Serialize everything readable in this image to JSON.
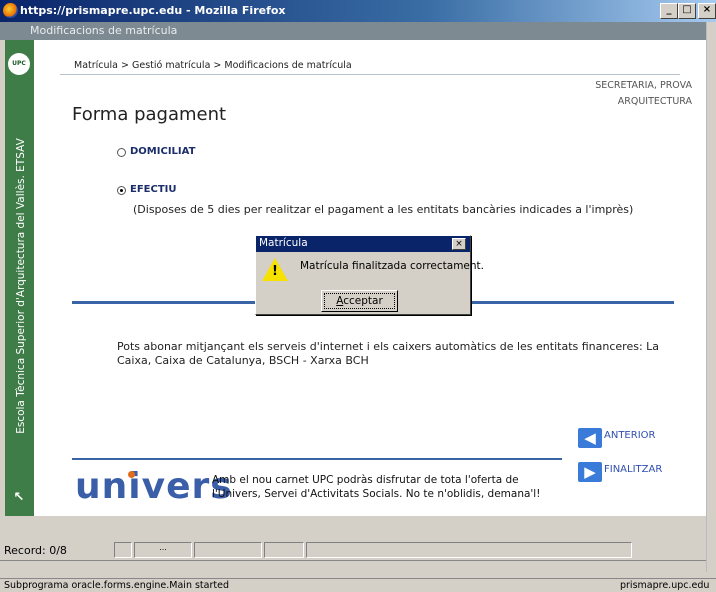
{
  "window": {
    "title": "https://prismapre.upc.edu - Mozilla Firefox",
    "controls": {
      "minimize": "_",
      "maximize": "□",
      "close": "×"
    }
  },
  "app": {
    "header": "Modificacions de matrícula",
    "sidebar_text": "Escola Tècnica Superior d'Arquitectura del Vallès. ETSAV",
    "logo_text": "UPC",
    "sidebar_arrow": "↖"
  },
  "breadcrumb": "Matrícula > Gestió matrícula > Modificacions de matrícula",
  "user": {
    "line1": "SECRETARIA, PROVA",
    "line2": "ARQUITECTURA"
  },
  "page_title": "Forma pagament",
  "options": [
    {
      "label": "DOMICILIAT",
      "selected": false
    },
    {
      "label": "EFECTIU",
      "selected": true
    }
  ],
  "efectiu_note": "(Disposes de 5 dies per realitzar el pagament a les entitats bancàries indicades a l'imprès)",
  "info_text": "Pots abonar mitjançant els serveis d'internet i els caixers automàtics de les entitats financeres: La Caixa, Caixa de Catalunya, BSCH - Xarxa BCH",
  "nav": {
    "previous": "ANTERIOR",
    "finish": "FINALITZAR"
  },
  "promo": {
    "logo": "univers",
    "text": "Amb el nou carnet UPC podràs disfrutar de tota l'oferta de l'Univers, Servei d'Activitats Socials. No te n'oblidis, demana'l!"
  },
  "dialog": {
    "title": "Matrícula",
    "message": "Matrícula finalitzada correctament.",
    "ok_prefix": "",
    "ok_accel": "A",
    "ok_rest": "cceptar",
    "close": "×"
  },
  "record_bar": {
    "record": "Record: 0/8",
    "ellipsis": "..."
  },
  "statusbar": {
    "left": "Subprograma oracle.forms.engine.Main started",
    "right": "prismapre.upc.edu"
  },
  "colors": {
    "sidebar": "#3e7d48",
    "accent_blue": "#3a64a8",
    "link": "#2f4fb0"
  }
}
